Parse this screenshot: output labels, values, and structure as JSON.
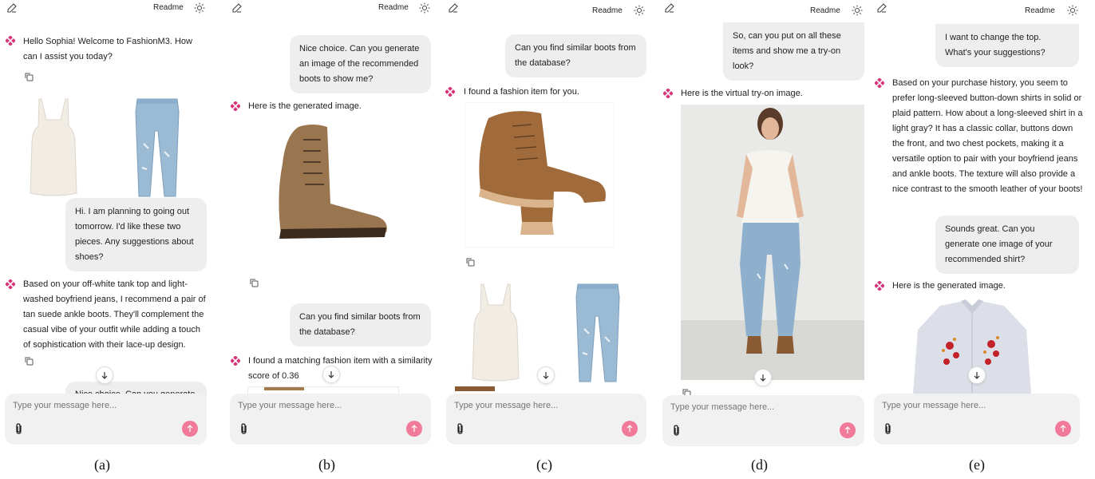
{
  "header": {
    "readme_label": "Readme"
  },
  "composer": {
    "placeholder": "Type your message here..."
  },
  "captions": [
    "(a)",
    "(b)",
    "(c)",
    "(d)",
    "(e)"
  ],
  "panel_a": {
    "greeting": "Hello Sophia! Welcome to FashionM3. How can I assist you today?",
    "user_msg_1": "Hi. I am planning to going out tomorrow. I'd like these two pieces. Any suggestions about shoes?",
    "bot_msg_1": "Based on your off-white tank top and light-washed boyfriend jeans, I recommend a pair of tan suede ankle boots. They'll complement the casual vibe of your outfit while adding a touch of sophistication with their lace-up design.",
    "user_msg_2_partial": "Nice choice. Can you generate"
  },
  "panel_b": {
    "user_msg_1": "Nice choice. Can you generate an image of the recommended boots to show me?",
    "bot_msg_1": "Here is the generated image.",
    "user_msg_2": "Can you find similar boots from the database?",
    "bot_msg_2": "I found a matching fashion item with a similarity score of 0.36"
  },
  "panel_c": {
    "user_msg_1": "Can you find similar boots from the database?",
    "bot_msg_1": "I found a fashion item for you."
  },
  "panel_d": {
    "user_msg_1": "So, can you put on all these items and show me a try-on look?",
    "bot_msg_1": "Here is the virtual try-on image."
  },
  "panel_e": {
    "user_msg_1": "I want to change the top. What's your suggestions?",
    "bot_msg_1": "Based on your purchase history, you seem to prefer long-sleeved button-down shirts in solid or plaid pattern. How about a long-sleeved shirt in a light gray? It has a classic collar, buttons down the front, and two chest pockets, making it a versatile option to pair with your boyfriend jeans and ankle boots. The texture will also provide a nice contrast to the smooth leather of your boots!",
    "user_msg_2": "Sounds great. Can you generate one image of your recommended shirt?",
    "bot_msg_2": "Here is the generated image."
  },
  "colors": {
    "accent": "#f17a9b",
    "logo": "#d6357a",
    "bubble": "#eeeeee",
    "composer": "#f1f1f1"
  },
  "icons": [
    "edit-icon",
    "sun-icon",
    "fashion-logo-icon",
    "copy-icon",
    "arrow-down-icon",
    "paperclip-icon",
    "arrow-up-icon"
  ]
}
